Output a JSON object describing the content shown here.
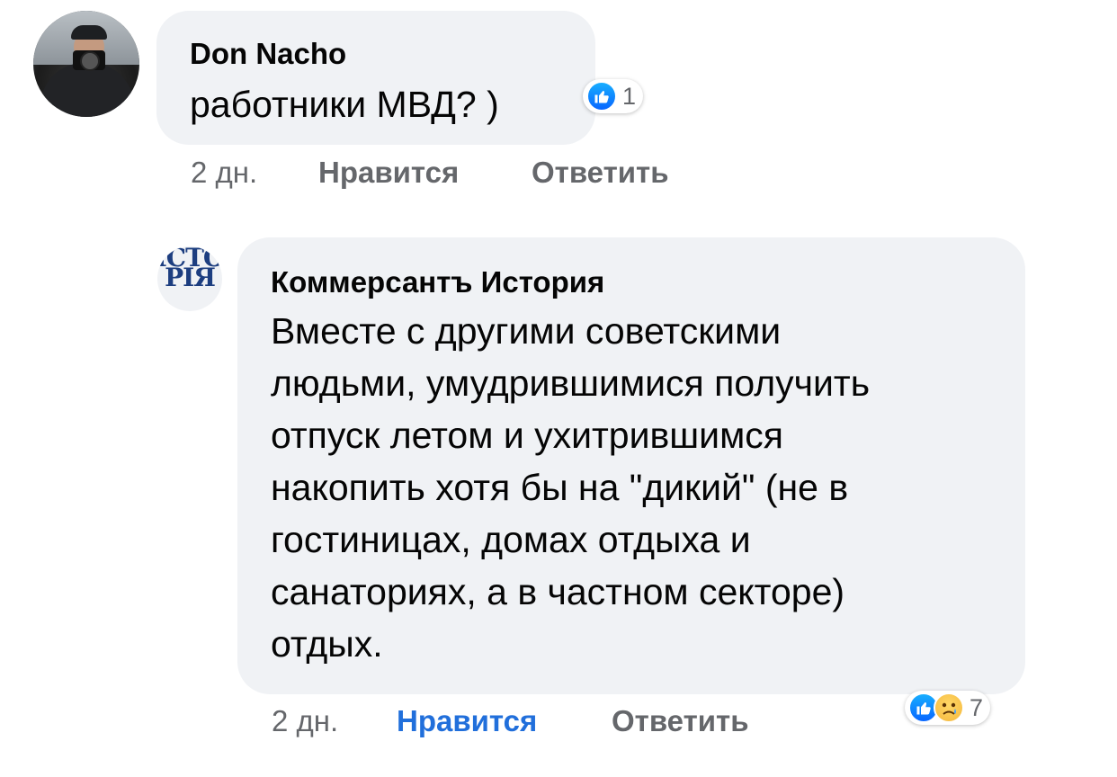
{
  "comments": [
    {
      "author": "Don Nacho",
      "text": "работники МВД? )",
      "time": "2 дн.",
      "like_label": "Нравится",
      "reply_label": "Ответить",
      "reaction_count": "1",
      "reaction_icons": [
        "like-icon"
      ],
      "liked_by_viewer": false
    },
    {
      "author": "Коммерсантъ История",
      "avatar_text": "ІСТО РІЯ",
      "text_lines": [
        "Вместе с другими советскими",
        "людьми, умудрившимися получить",
        "отпуск летом и ухитрившимся",
        "накопить хотя бы на \"дикий\" (не в",
        "гостиницах, домах отдыха и",
        "санаториях, а в частном секторе)",
        "отдых."
      ],
      "time": "2 дн.",
      "like_label": "Нравится",
      "reply_label": "Ответить",
      "reaction_count": "7",
      "reaction_icons": [
        "like-icon",
        "sad-icon"
      ],
      "liked_by_viewer": true
    }
  ],
  "colors": {
    "bubble_bg": "#f0f2f5",
    "meta_text": "#65676b",
    "liked_blue": "#216fdb",
    "like_reaction": "#0866ff"
  }
}
